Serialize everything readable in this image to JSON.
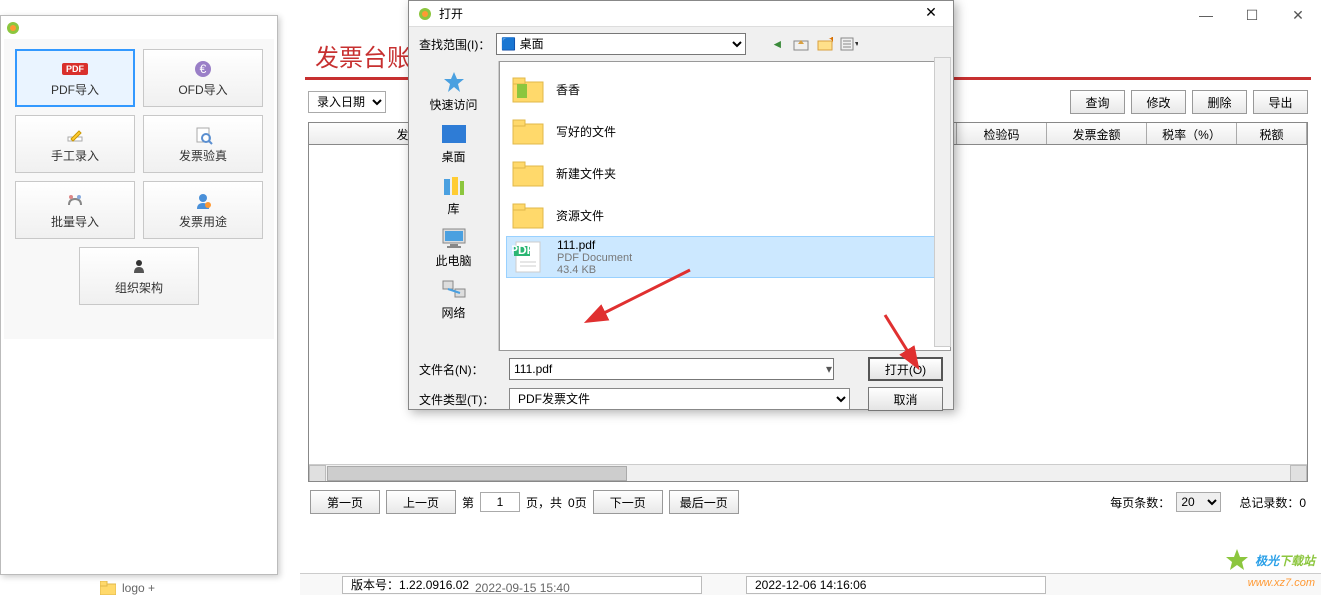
{
  "window": {
    "minimize": "—",
    "maximize": "☐",
    "close": "✕"
  },
  "sidebar": {
    "buttons": [
      {
        "label": "PDF导入",
        "icon": "pdf"
      },
      {
        "label": "OFD导入",
        "icon": "ofd"
      },
      {
        "label": "手工录入",
        "icon": "edit"
      },
      {
        "label": "发票验真",
        "icon": "verify"
      },
      {
        "label": "批量导入",
        "icon": "batch"
      },
      {
        "label": "发票用途",
        "icon": "usage"
      },
      {
        "label": "组织架构",
        "icon": "org"
      }
    ]
  },
  "main": {
    "title": "发票台账",
    "filter_type": "录入日期",
    "actions": [
      "查询",
      "修改",
      "删除",
      "导出"
    ],
    "columns": [
      "发票",
      "检验码",
      "发票金额",
      "税率（%）",
      "税额"
    ]
  },
  "pagination": {
    "first": "第一页",
    "prev": "上一页",
    "page_prefix": "第",
    "page_input": "1",
    "page_mid": "页，共",
    "total_pages": "0页",
    "next": "下一页",
    "last": "最后一页",
    "per_page_label": "每页条数：",
    "per_page_value": "20",
    "total_records": "总记录数：0"
  },
  "statusbar": {
    "version_label": "版本号：",
    "version": "1.22.0916.02",
    "datetime": "2022-12-06 14:16:06",
    "bottom_time": "2022-09-15 15:40",
    "bottom_logo": "logo +"
  },
  "dialog": {
    "title": "打开",
    "lookup_label": "查找范围(I)：",
    "lookup_value": "桌面",
    "places": [
      "快速访问",
      "桌面",
      "库",
      "此电脑",
      "网络"
    ],
    "files": [
      {
        "name": "香香",
        "type": "folder"
      },
      {
        "name": "写好的文件",
        "type": "folder"
      },
      {
        "name": "新建文件夹",
        "type": "folder"
      },
      {
        "name": "资源文件",
        "type": "folder"
      },
      {
        "name": "111.pdf",
        "type": "pdf",
        "meta1": "PDF Document",
        "meta2": "43.4 KB",
        "selected": true
      }
    ],
    "filename_label": "文件名(N)：",
    "filename_value": "111.pdf",
    "filetype_label": "文件类型(T)：",
    "filetype_value": "PDF发票文件",
    "open_btn": "打开(O)",
    "cancel_btn": "取消"
  },
  "watermark": {
    "text1": "极光",
    "text2": "下载站",
    "url": "www.xz7.com"
  }
}
